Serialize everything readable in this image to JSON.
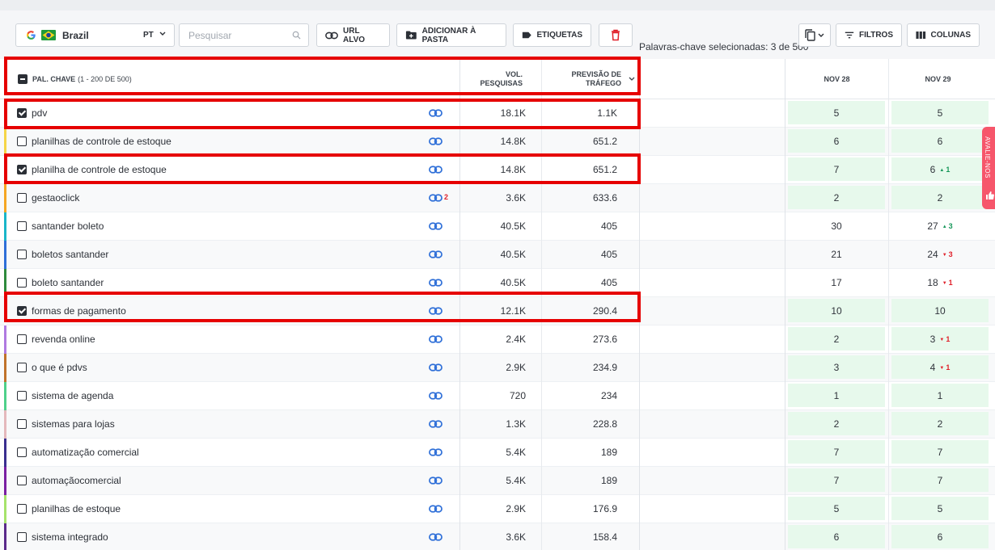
{
  "toolbar": {
    "country": "Brazil",
    "language": "PT",
    "search_placeholder": "Pesquisar",
    "url_button": "URL ALVO",
    "folder_button": "ADICIONAR À PASTA",
    "tags_button": "ETIQUETAS",
    "selection_status": "Palavras-chave selecionadas: 3 de 500",
    "filters_button": "FILTROS",
    "columns_button": "COLUNAS"
  },
  "table": {
    "keyword_header": "PAL. CHAVE",
    "keyword_count": "(1 - 200 DE 500)",
    "volume_header_1": "VOL.",
    "volume_header_2": "PESQUISAS",
    "traffic_header_1": "PREVISÃO DE",
    "traffic_header_2": "TRÁFEGO",
    "date1_header": "NOV 28",
    "date2_header": "NOV 29",
    "rows": [
      {
        "keyword": "pdv",
        "checked": true,
        "tag_color": "#ffffff",
        "link_count": "",
        "volume": "18.1K",
        "traffic": "1.1K",
        "pos1": "5",
        "pos2": "5",
        "change": "",
        "change_dir": "",
        "hl1": true,
        "hl2": true
      },
      {
        "keyword": "planilhas de controle de estoque",
        "checked": false,
        "tag_color": "#f5d547",
        "link_count": "",
        "volume": "14.8K",
        "traffic": "651.2",
        "pos1": "6",
        "pos2": "6",
        "change": "",
        "change_dir": "",
        "hl1": true,
        "hl2": true
      },
      {
        "keyword": "planilha de controle de estoque",
        "checked": true,
        "tag_color": "#ffffff",
        "link_count": "",
        "volume": "14.8K",
        "traffic": "651.2",
        "pos1": "7",
        "pos2": "6",
        "change": "1",
        "change_dir": "up",
        "hl1": true,
        "hl2": true
      },
      {
        "keyword": "gestaoclick",
        "checked": false,
        "tag_color": "#f5a623",
        "link_count": "2",
        "volume": "3.6K",
        "traffic": "633.6",
        "pos1": "2",
        "pos2": "2",
        "change": "",
        "change_dir": "",
        "hl1": true,
        "hl2": true
      },
      {
        "keyword": "santander boleto",
        "checked": false,
        "tag_color": "#1ab6c9",
        "link_count": "",
        "volume": "40.5K",
        "traffic": "405",
        "pos1": "30",
        "pos2": "27",
        "change": "3",
        "change_dir": "up",
        "hl1": false,
        "hl2": false
      },
      {
        "keyword": "boletos santander",
        "checked": false,
        "tag_color": "#2e6fd8",
        "link_count": "",
        "volume": "40.5K",
        "traffic": "405",
        "pos1": "21",
        "pos2": "24",
        "change": "3",
        "change_dir": "dn",
        "hl1": false,
        "hl2": false
      },
      {
        "keyword": "boleto santander",
        "checked": false,
        "tag_color": "#2e8b3d",
        "link_count": "",
        "volume": "40.5K",
        "traffic": "405",
        "pos1": "17",
        "pos2": "18",
        "change": "1",
        "change_dir": "dn",
        "hl1": false,
        "hl2": false
      },
      {
        "keyword": "formas de pagamento",
        "checked": true,
        "tag_color": "#ffffff",
        "link_count": "",
        "volume": "12.1K",
        "traffic": "290.4",
        "pos1": "10",
        "pos2": "10",
        "change": "",
        "change_dir": "",
        "hl1": true,
        "hl2": true
      },
      {
        "keyword": "revenda online",
        "checked": false,
        "tag_color": "#b07ae0",
        "link_count": "",
        "volume": "2.4K",
        "traffic": "273.6",
        "pos1": "2",
        "pos2": "3",
        "change": "1",
        "change_dir": "dn",
        "hl1": true,
        "hl2": true
      },
      {
        "keyword": "o que é pdvs",
        "checked": false,
        "tag_color": "#c0722a",
        "link_count": "",
        "volume": "2.9K",
        "traffic": "234.9",
        "pos1": "3",
        "pos2": "4",
        "change": "1",
        "change_dir": "dn",
        "hl1": true,
        "hl2": true
      },
      {
        "keyword": "sistema de agenda",
        "checked": false,
        "tag_color": "#4fd08a",
        "link_count": "",
        "volume": "720",
        "traffic": "234",
        "pos1": "1",
        "pos2": "1",
        "change": "",
        "change_dir": "",
        "hl1": true,
        "hl2": true
      },
      {
        "keyword": "sistemas para lojas",
        "checked": false,
        "tag_color": "#e4b8bc",
        "link_count": "",
        "volume": "1.3K",
        "traffic": "228.8",
        "pos1": "2",
        "pos2": "2",
        "change": "",
        "change_dir": "",
        "hl1": true,
        "hl2": true
      },
      {
        "keyword": "automatização comercial",
        "checked": false,
        "tag_color": "#3a2f8f",
        "link_count": "",
        "volume": "5.4K",
        "traffic": "189",
        "pos1": "7",
        "pos2": "7",
        "change": "",
        "change_dir": "",
        "hl1": true,
        "hl2": true
      },
      {
        "keyword": "automaçãocomercial",
        "checked": false,
        "tag_color": "#7a1fa2",
        "link_count": "",
        "volume": "5.4K",
        "traffic": "189",
        "pos1": "7",
        "pos2": "7",
        "change": "",
        "change_dir": "",
        "hl1": true,
        "hl2": true
      },
      {
        "keyword": "planilhas de estoque",
        "checked": false,
        "tag_color": "#a6e36b",
        "link_count": "",
        "volume": "2.9K",
        "traffic": "176.9",
        "pos1": "5",
        "pos2": "5",
        "change": "",
        "change_dir": "",
        "hl1": true,
        "hl2": true
      },
      {
        "keyword": "sistema integrado",
        "checked": false,
        "tag_color": "#5a2a8a",
        "link_count": "",
        "volume": "3.6K",
        "traffic": "158.4",
        "pos1": "6",
        "pos2": "6",
        "change": "",
        "change_dir": "",
        "hl1": true,
        "hl2": true
      }
    ]
  },
  "feedback_tab": "AVALIE-NOS",
  "colors": {
    "accent_red": "#e60000",
    "link_blue": "#2e6fd8",
    "highlight_green": "#e7f9ec",
    "up": "#17975a",
    "down": "#e0202a"
  }
}
